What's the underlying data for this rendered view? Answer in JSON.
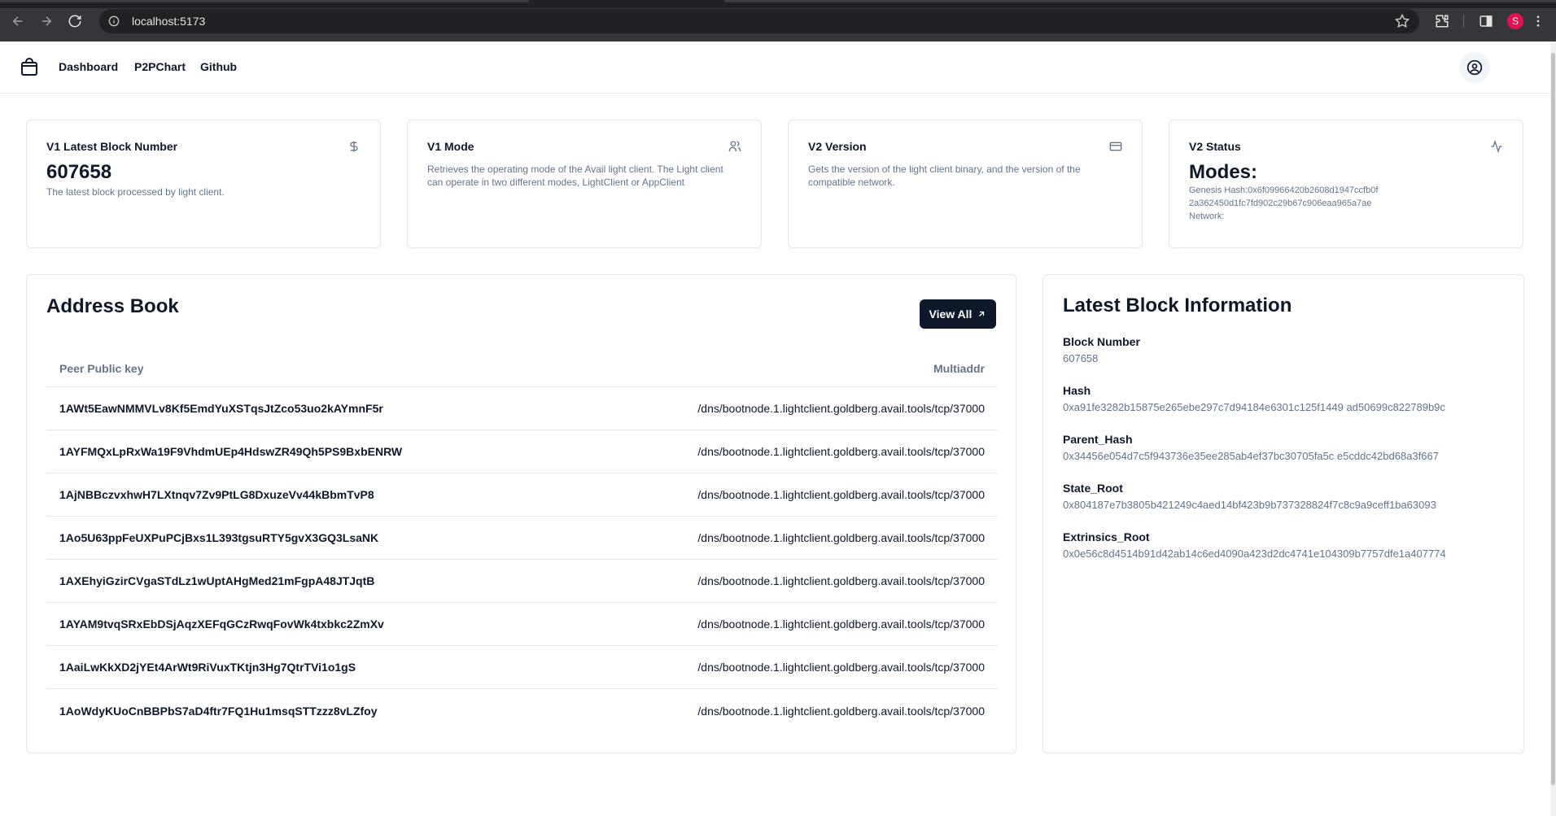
{
  "browser": {
    "url": "localhost:5173",
    "profile_initial": "S"
  },
  "nav": {
    "links": [
      "Dashboard",
      "P2PChart",
      "Github"
    ]
  },
  "stats": [
    {
      "label": "V1 Latest Block Number",
      "icon": "dollar-icon",
      "value": "607658",
      "desc": "The latest block processed by light client."
    },
    {
      "label": "V1 Mode",
      "icon": "users-icon",
      "desc": "Retrieves the operating mode of the Avail light client. The Light client can operate in two different modes, LightClient or AppClient"
    },
    {
      "label": "V2 Version",
      "icon": "credit-card-icon",
      "desc": "Gets the version of the light client binary, and the version of the compatible network."
    },
    {
      "label": "V2 Status",
      "icon": "activity-icon",
      "value": "Modes:",
      "genesis": "Genesis Hash:0x6f09966420b2608d1947ccfb0f 2a362450d1fc7fd902c29b67c906eaa965a7ae",
      "network": "Network:"
    }
  ],
  "address_book": {
    "title": "Address Book",
    "view_all": "View All",
    "columns": [
      "Peer Public key",
      "Multiaddr"
    ],
    "rows": [
      {
        "key": "1AWt5EawNMMVLv8Kf5EmdYuXSTqsJtZco53uo2kAYmnF5r",
        "addr": "/dns/bootnode.1.lightclient.goldberg.avail.tools/tcp/37000"
      },
      {
        "key": "1AYFMQxLpRxWa19F9VhdmUEp4HdswZR49Qh5PS9BxbENRW",
        "addr": "/dns/bootnode.1.lightclient.goldberg.avail.tools/tcp/37000"
      },
      {
        "key": "1AjNBBczvxhwH7LXtnqv7Zv9PtLG8DxuzeVv44kBbmTvP8",
        "addr": "/dns/bootnode.1.lightclient.goldberg.avail.tools/tcp/37000"
      },
      {
        "key": "1Ao5U63ppFeUXPuPCjBxs1L393tgsuRTY5gvX3GQ3LsaNK",
        "addr": "/dns/bootnode.1.lightclient.goldberg.avail.tools/tcp/37000"
      },
      {
        "key": "1AXEhyiGzirCVgaSTdLz1wUptAHgMed21mFgpA48JTJqtB",
        "addr": "/dns/bootnode.1.lightclient.goldberg.avail.tools/tcp/37000"
      },
      {
        "key": "1AYAM9tvqSRxEbDSjAqzXEFqGCzRwqFovWk4txbkc2ZmXv",
        "addr": "/dns/bootnode.1.lightclient.goldberg.avail.tools/tcp/37000"
      },
      {
        "key": "1AaiLwKkXD2jYEt4ArWt9RiVuxTKtjn3Hg7QtrTVi1o1gS",
        "addr": "/dns/bootnode.1.lightclient.goldberg.avail.tools/tcp/37000"
      },
      {
        "key": "1AoWdyKUoCnBBPbS7aD4ftr7FQ1Hu1msqSTTzzz8vLZfoy",
        "addr": "/dns/bootnode.1.lightclient.goldberg.avail.tools/tcp/37000"
      }
    ]
  },
  "latest_block": {
    "title": "Latest Block Information",
    "fields": [
      {
        "label": "Block Number",
        "value": "607658"
      },
      {
        "label": "Hash",
        "value": "0xa91fe3282b15875e265ebe297c7d94184e6301c125f1449 ad50699c822789b9c"
      },
      {
        "label": "Parent_Hash",
        "value": "0x34456e054d7c5f943736e35ee285ab4ef37bc30705fa5c e5cddc42bd68a3f667"
      },
      {
        "label": "State_Root",
        "value": "0x804187e7b3805b421249c4aed14bf423b9b737328824f7c8c9a9ceff1ba63093"
      },
      {
        "label": "Extrinsics_Root",
        "value": "0x0e56c8d4514b91d42ab14c6ed4090a423d2dc4741e104309b7757dfe1a407774"
      }
    ]
  }
}
